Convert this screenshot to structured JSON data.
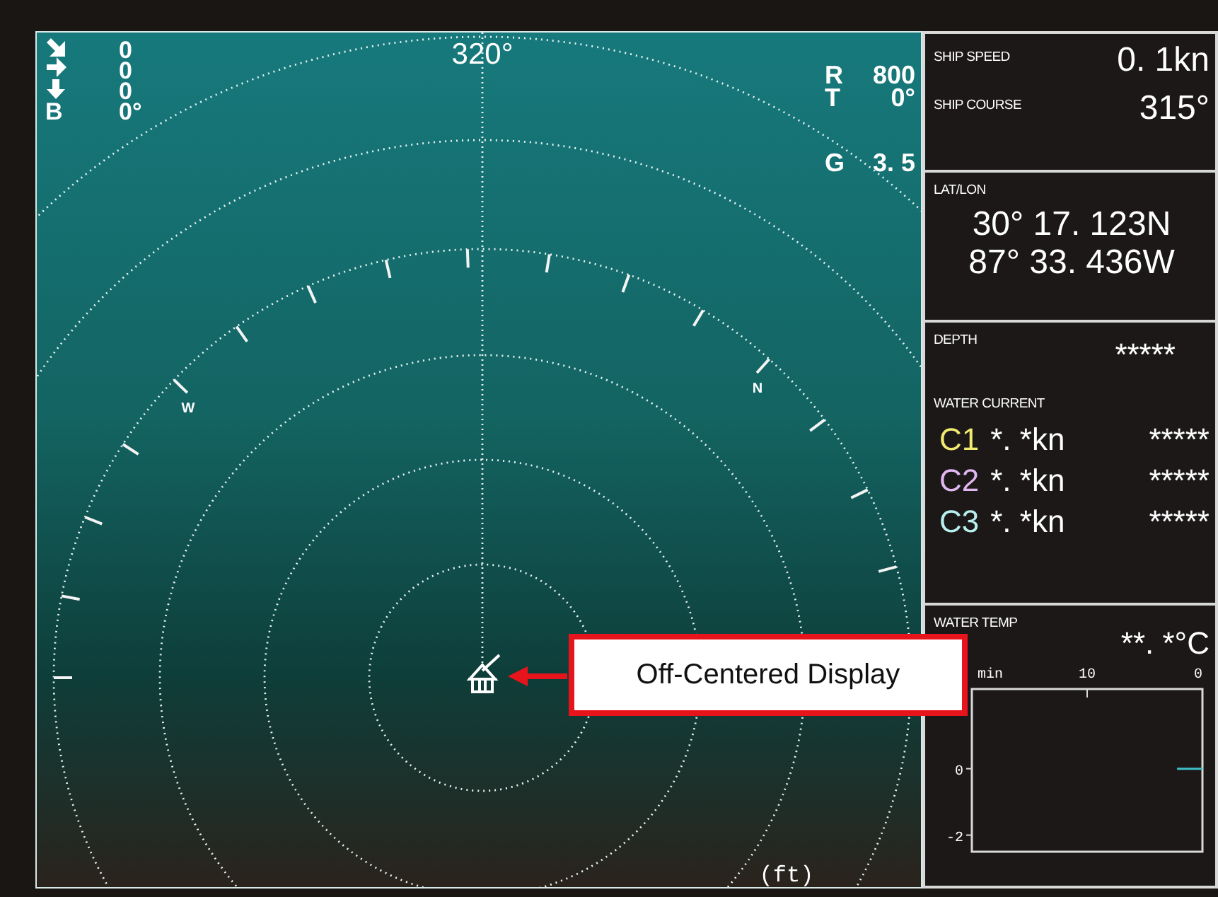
{
  "sonar": {
    "heading": "320°",
    "indicators": [
      {
        "kind": "diagonal",
        "value": "0"
      },
      {
        "kind": "right",
        "value": "0"
      },
      {
        "kind": "down",
        "value": "0"
      },
      {
        "kind": "letter",
        "label": "B",
        "value": "0°"
      }
    ],
    "range": [
      {
        "label": "R",
        "value": "800"
      },
      {
        "label": "T",
        "value": "0°"
      },
      {
        "label": "G",
        "value": "3. 5"
      }
    ],
    "compass": [
      {
        "kind": "west",
        "label": "W"
      },
      {
        "kind": "north",
        "label": "N"
      }
    ],
    "unit": "(ft)"
  },
  "callout": {
    "text": "Off-Centered Display"
  },
  "panel": {
    "ship_speed": {
      "label": "SHIP SPEED",
      "value": "0. 1kn"
    },
    "ship_course": {
      "label": "SHIP COURSE",
      "value": "315°"
    },
    "lat_lon": {
      "label": "LAT/LON",
      "lat": "30° 17. 123N",
      "lon": "87° 33. 436W"
    },
    "depth": {
      "label": "DEPTH",
      "value": "*****"
    },
    "water_current": {
      "label": "WATER CURRENT",
      "rows": [
        {
          "name": "C1",
          "color": "#f0ea70",
          "speed": "*. *kn",
          "direction": "*****"
        },
        {
          "name": "C2",
          "color": "#e0b8f0",
          "speed": "*. *kn",
          "direction": "*****"
        },
        {
          "name": "C3",
          "color": "#b8f0ee",
          "speed": "*. *kn",
          "direction": "*****"
        }
      ]
    },
    "water_temp": {
      "label": "WATER TEMP",
      "value": "**. *°C",
      "chart_data": {
        "type": "line",
        "xlabel": "min",
        "x": [
          2.2,
          0
        ],
        "xlim": [
          20,
          0
        ],
        "ylim": [
          -2.5,
          2.4
        ],
        "xticks": [
          10,
          0
        ],
        "yticks": [
          0,
          -2
        ],
        "series": [
          {
            "color": "#3fc0c8",
            "values": [
              0,
              0
            ]
          }
        ]
      }
    }
  }
}
